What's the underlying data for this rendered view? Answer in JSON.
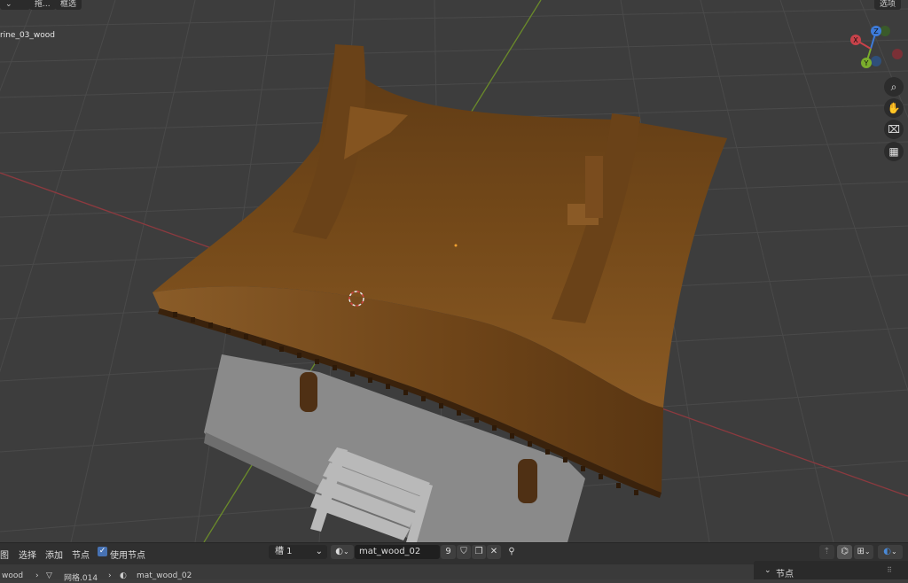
{
  "header": {
    "dropdown_left_label": "拖...",
    "dropdown_mid_label": "框选",
    "options_label": "选项"
  },
  "viewport": {
    "object_name": "rine_03_wood",
    "gizmo": {
      "x_label": "X",
      "y_label": "Y",
      "z_label": "Z"
    },
    "tools": [
      "zoom-icon",
      "hand-icon",
      "camera-icon",
      "grid-icon"
    ]
  },
  "footer": {
    "menu_view": "图",
    "menu_select": "选择",
    "menu_add": "添加",
    "menu_node": "节点",
    "use_nodes_label": "使用节点",
    "slot_label": "槽 1",
    "material_name": "mat_wood_02",
    "user_count": "9"
  },
  "breadcrumb": {
    "item_object": "wood",
    "item_mesh": "网格.014",
    "item_material": "mat_wood_02"
  },
  "side_panel": {
    "section_label": "节点"
  },
  "colors": {
    "accent": "#4772b3",
    "axis_red": "#c8424a",
    "axis_green": "#7aad2c",
    "axis_blue": "#3d7bd9",
    "roof_wood": "#7a4c1e"
  }
}
